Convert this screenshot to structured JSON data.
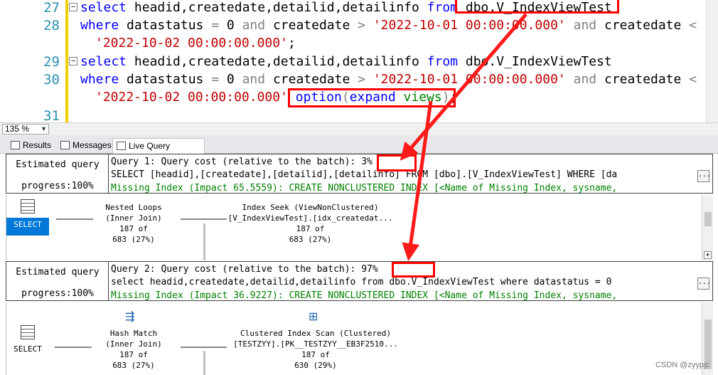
{
  "editor": {
    "line_numbers": [
      "27",
      "28",
      "29",
      "30",
      "31"
    ],
    "q1_line1": {
      "kw1": "select",
      "cols": " headid,createdate,detailid,detailinfo ",
      "kw2": "from",
      "tbl": " dbo.V_IndexViewTest"
    },
    "q1_line2": {
      "kw1": "where",
      "a": " datastatus ",
      "eq": "=",
      "b": " 0 ",
      "and1": "and",
      "c": " createdate ",
      "gt": ">",
      "d": " ",
      "s1": "'2022-10-01 00:00:00.000'",
      "e": " ",
      "and2": "and",
      "f": " createdate ",
      "lt": "<"
    },
    "q1_line3": {
      "s2": "'2022-10-02 00:00:00.000'",
      "semi": ";"
    },
    "q2_line1": {
      "kw1": "select",
      "cols": " headid,createdate,detailid,detailinfo ",
      "kw2": "from",
      "tbl": " dbo.V_IndexViewTest"
    },
    "q2_line2": {
      "kw1": "where",
      "a": " datastatus ",
      "eq": "=",
      "b": " 0 ",
      "and1": "and",
      "c": " createdate ",
      "gt": ">",
      "d": " ",
      "s1": "'2022-10-01 00:00:00.000'",
      "e": " ",
      "and2": "and",
      "f": " createdate ",
      "lt": "<"
    },
    "q2_line3": {
      "s2": "'2022-10-02 00:00:00.000'",
      "sp": " ",
      "opt": "option",
      "p1": "(",
      "exp": "expand",
      "sp2": " ",
      "views": "views",
      "p2": ")",
      "semi": ";"
    }
  },
  "zoom": {
    "value": "135 %",
    "dropdown_icon": "chevron-down-icon"
  },
  "tabs": [
    {
      "label": "Results",
      "icon": "grid-icon"
    },
    {
      "label": "Messages",
      "icon": "messages-icon"
    },
    {
      "label": "Live Query Statistics",
      "icon": "live-stats-icon"
    }
  ],
  "query1": {
    "left1": "Estimated query",
    "left2": "progress:100%",
    "line1": "Query 1: Query cost (relative to the batch): 3%",
    "line2": "SELECT [headid],[createdate],[detailid],[detailinfo] FROM [dbo].[V_IndexViewTest] WHERE [da",
    "line3": "Missing Index (Impact 65.5559): CREATE NONCLUSTERED INDEX [<Name of Missing Index, sysname,",
    "dots": "...",
    "nodes": {
      "select": "SELECT",
      "nested": "Nested Loops\n(Inner Join)\n187 of\n683 (27%)",
      "seek": "Index Seek (ViewNonClustered)\n[V_IndexViewTest].[idx_createdat...\n187 of\n683 (27%)"
    },
    "scroll_plus": "+"
  },
  "query2": {
    "left1": "Estimated query",
    "left2": "progress:100%",
    "line1": "Query 2: Query cost (relative to the batch): 97%",
    "line2": "select headid,createdate,detailid,detailinfo from dbo.V_IndexViewTest where datastatus = 0",
    "line3": "Missing Index (Impact 36.9227): CREATE NONCLUSTERED INDEX [<Name of Missing Index, sysname,",
    "dots": "...",
    "nodes": {
      "select": "SELECT",
      "hash": "Hash Match\n(Inner Join)\n187 of\n683 (27%)",
      "scan": "Clustered Index Scan (Clustered)\n[TESTZYY].[PK__TESTZYY__EB3F2510...\n187 of\n630 (29%)"
    }
  },
  "watermark": "CSDN @zyypjc",
  "colors": {
    "highlight": "#ff0000",
    "keyword": "#0000ff",
    "string": "#c00000",
    "missing_index": "#008000"
  }
}
